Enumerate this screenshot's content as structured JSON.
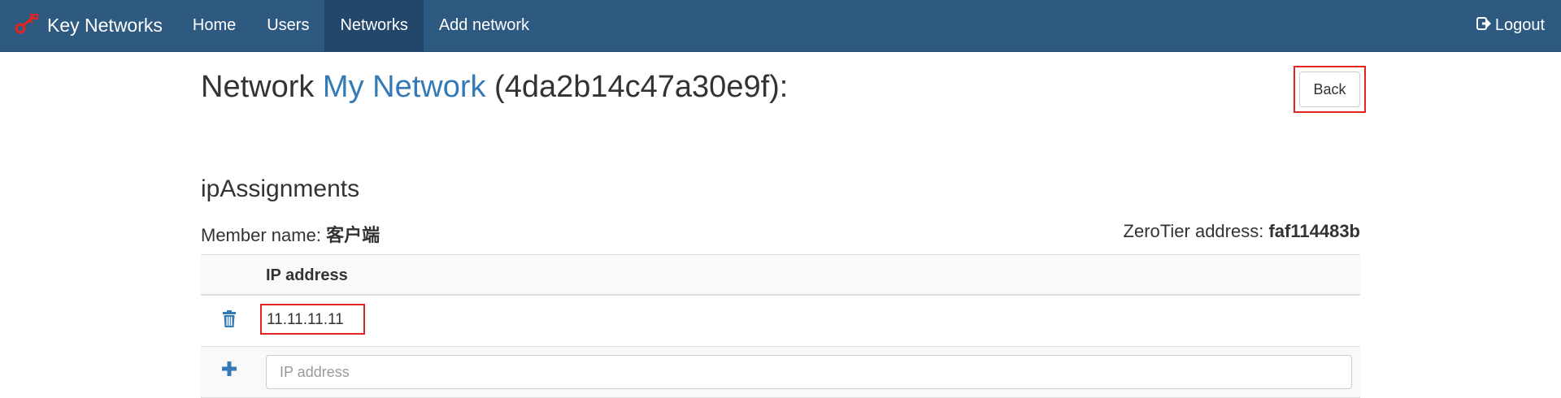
{
  "navbar": {
    "brand": "Key Networks",
    "items": [
      {
        "label": "Home"
      },
      {
        "label": "Users"
      },
      {
        "label": "Networks",
        "active": true
      },
      {
        "label": "Add network"
      }
    ],
    "logout": "Logout",
    "colors": {
      "background": "#2e5980",
      "active": "#22476a",
      "logo": "#e0261e"
    }
  },
  "page": {
    "title_prefix": "Network ",
    "network_name": "My Network",
    "network_id": " (4da2b14c47a30e9f):",
    "back_label": "Back",
    "section_title": "ipAssignments",
    "member_label": "Member name: ",
    "member_name": "客户端",
    "zerotier_label": "ZeroTier address: ",
    "zerotier_address": "faf114483b"
  },
  "table": {
    "header": "IP address",
    "rows": [
      {
        "ip": "11.11.11.11",
        "icon": "trash-icon"
      }
    ],
    "new_row": {
      "icon": "plus-icon",
      "placeholder": "IP address",
      "value": ""
    }
  },
  "colors": {
    "link": "#337ab7",
    "highlight": "#e0261e"
  }
}
